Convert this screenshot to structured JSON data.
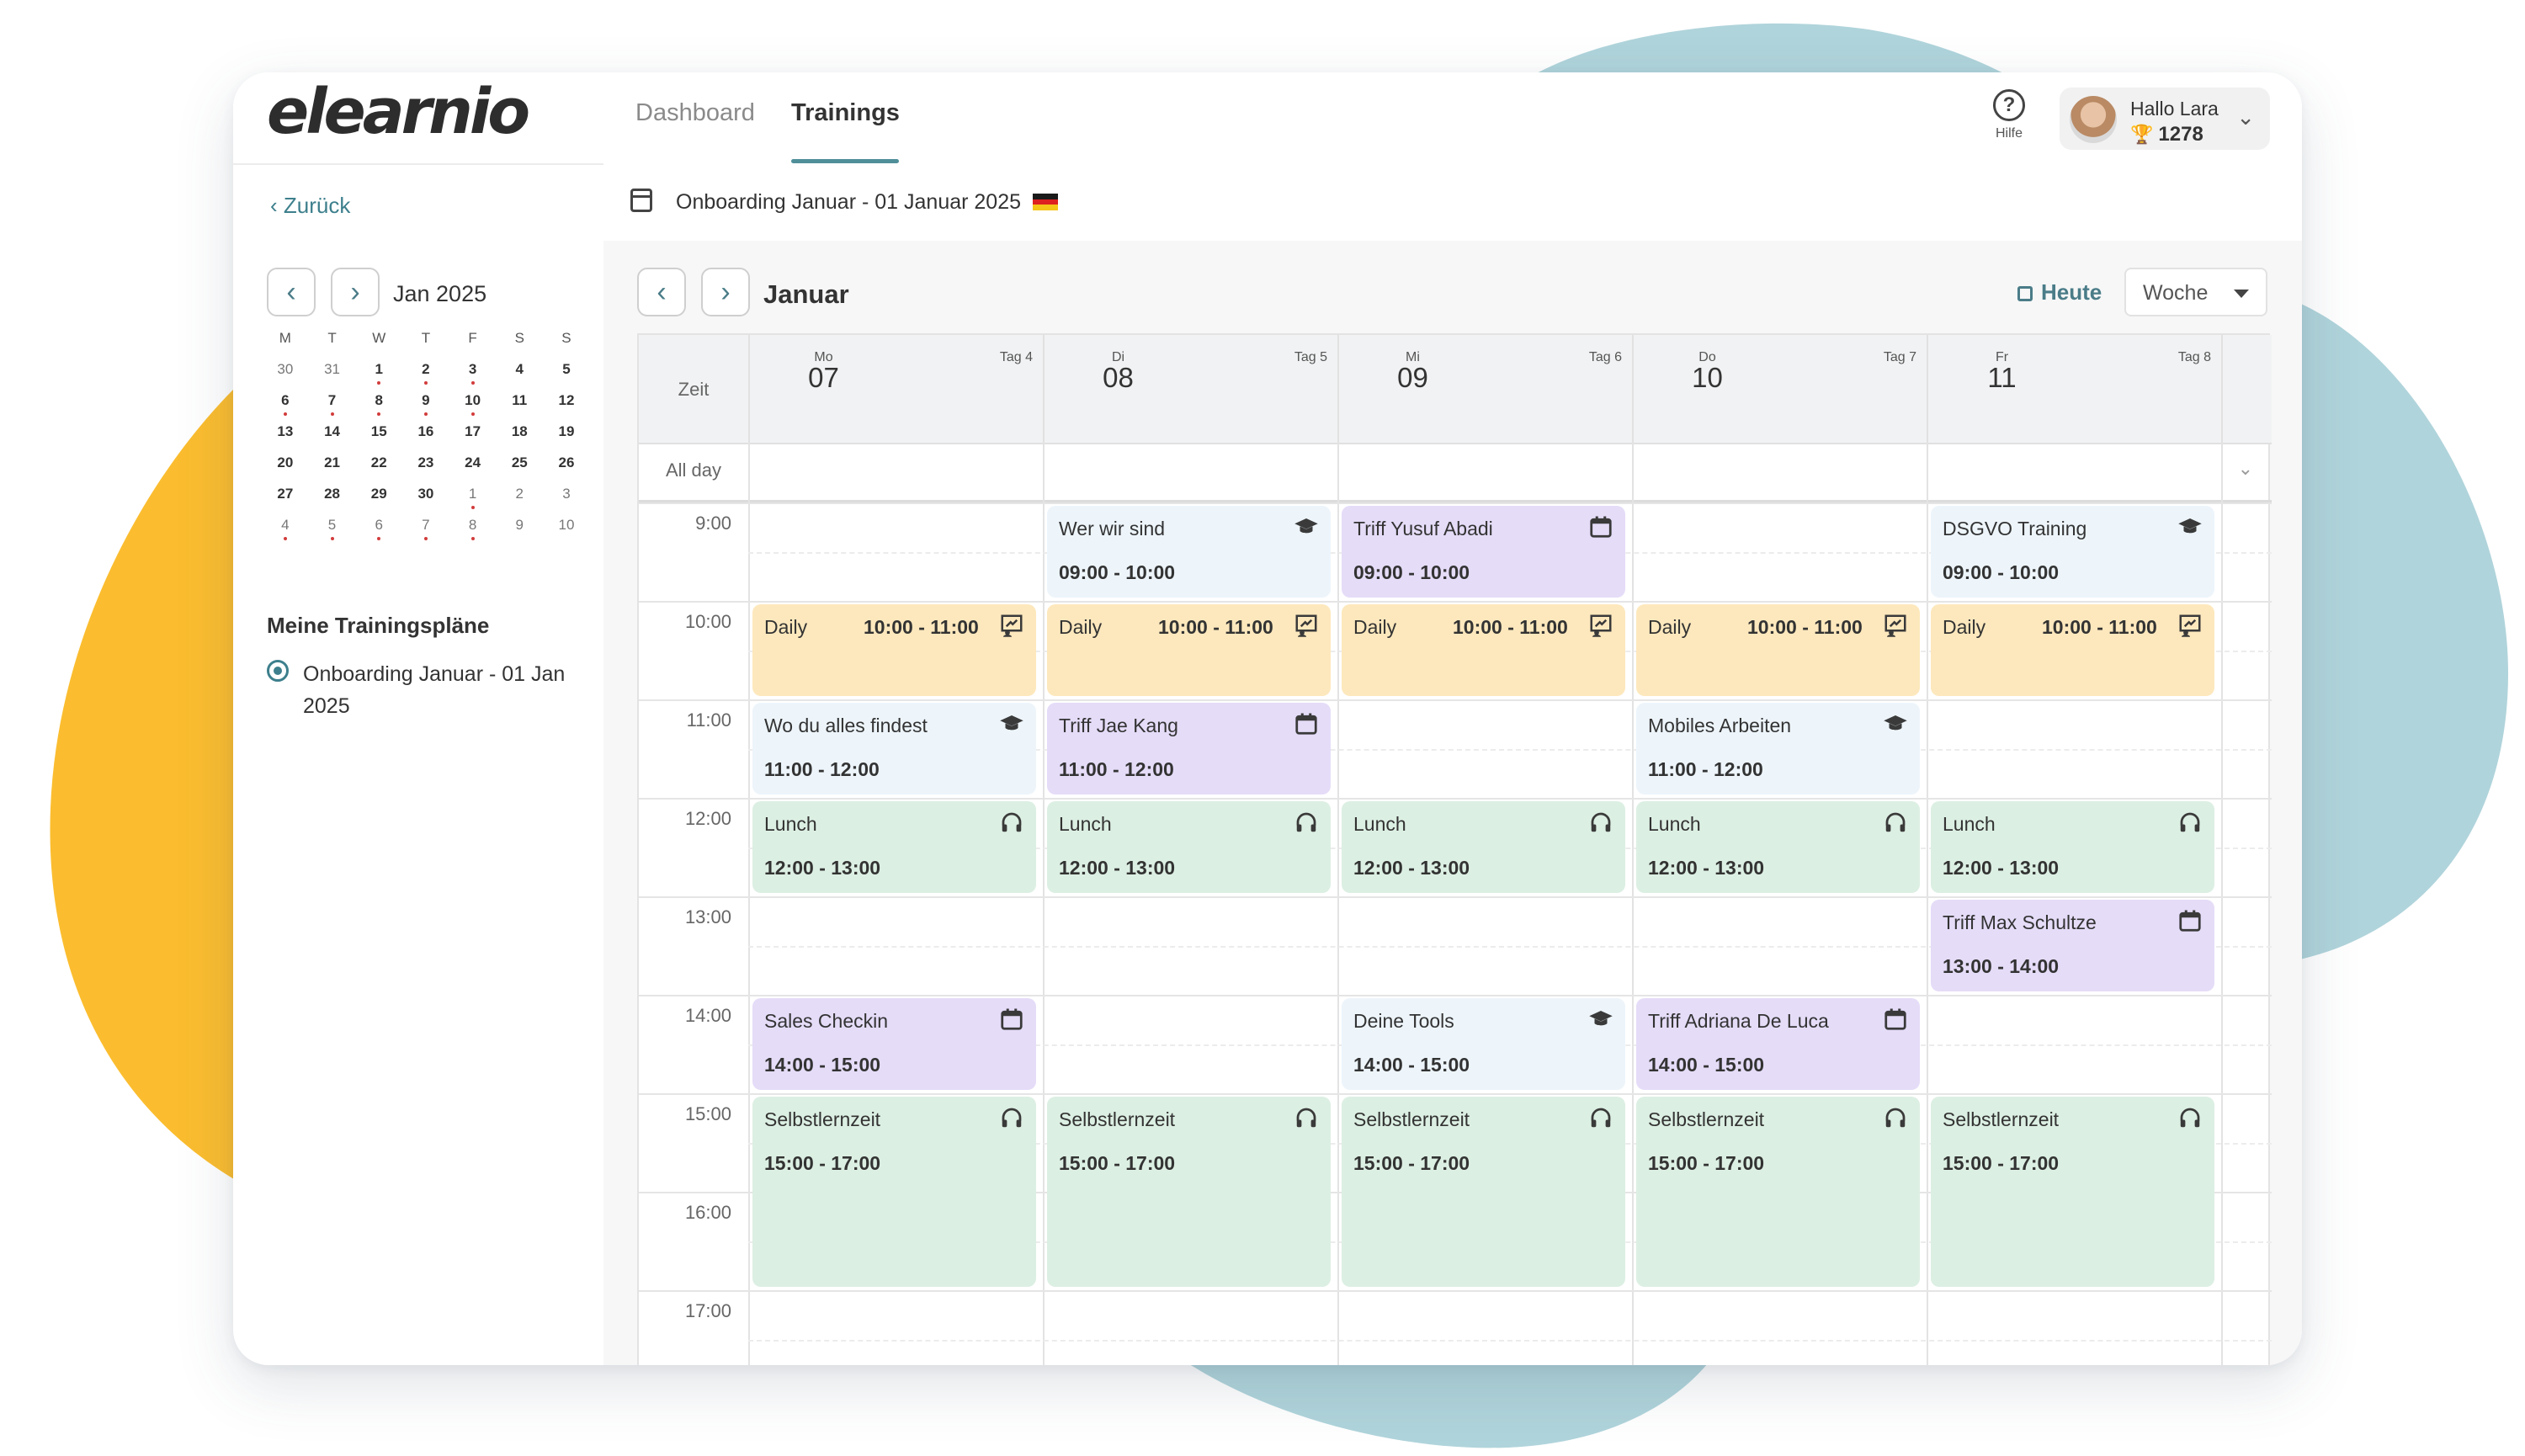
{
  "app": {
    "logo": "elearnio"
  },
  "nav": {
    "dashboard": "Dashboard",
    "trainings": "Trainings"
  },
  "help": {
    "label": "Hilfe"
  },
  "user": {
    "greeting": "Hallo Lara",
    "points": "1278"
  },
  "sidebar": {
    "back": "Zurück",
    "minical": {
      "month": "Jan 2025",
      "weekdays": [
        "M",
        "T",
        "W",
        "T",
        "F",
        "S",
        "S"
      ],
      "weeks": [
        [
          "30",
          "31",
          "1",
          "2",
          "3",
          "4",
          "5"
        ],
        [
          "6",
          "7",
          "8",
          "9",
          "10",
          "11",
          "12"
        ],
        [
          "13",
          "14",
          "15",
          "16",
          "17",
          "18",
          "19"
        ],
        [
          "20",
          "21",
          "22",
          "23",
          "24",
          "25",
          "26"
        ],
        [
          "27",
          "28",
          "29",
          "30",
          "1",
          "2",
          "3"
        ],
        [
          "4",
          "5",
          "6",
          "7",
          "8",
          "9",
          "10"
        ]
      ]
    },
    "plans_title": "Meine Trainingspläne",
    "plan": "Onboarding Januar - 01 Jan 2025"
  },
  "subheader": {
    "title": "Onboarding Januar - 01 Januar 2025"
  },
  "calendar": {
    "month": "Januar",
    "today": "Heute",
    "view": "Woche",
    "zeit": "Zeit",
    "allday": "All day",
    "days": [
      {
        "abbr": "Mo",
        "num": "07",
        "tag": "Tag 4"
      },
      {
        "abbr": "Di",
        "num": "08",
        "tag": "Tag 5"
      },
      {
        "abbr": "Mi",
        "num": "09",
        "tag": "Tag 6"
      },
      {
        "abbr": "Do",
        "num": "10",
        "tag": "Tag 7"
      },
      {
        "abbr": "Fr",
        "num": "11",
        "tag": "Tag 8"
      }
    ],
    "times": [
      "9:00",
      "10:00",
      "11:00",
      "12:00",
      "13:00",
      "14:00",
      "15:00",
      "16:00",
      "17:00"
    ],
    "events": [
      {
        "day": 1,
        "start": 9,
        "end": 10,
        "title": "Wer wir sind",
        "time": "09:00 - 10:00",
        "color": "blue",
        "icon": "graduation-cap-icon"
      },
      {
        "day": 2,
        "start": 9,
        "end": 10,
        "title": "Triff Yusuf Abadi",
        "time": "09:00 - 10:00",
        "color": "purple",
        "icon": "calendar-icon"
      },
      {
        "day": 4,
        "start": 9,
        "end": 10,
        "title": "DSGVO Training",
        "time": "09:00 - 10:00",
        "color": "blue",
        "icon": "graduation-cap-icon"
      },
      {
        "day": 0,
        "start": 10,
        "end": 11,
        "title": "Daily",
        "time": "10:00 - 11:00",
        "color": "yellow",
        "icon": "presentation-icon",
        "inline": true
      },
      {
        "day": 1,
        "start": 10,
        "end": 11,
        "title": "Daily",
        "time": "10:00 - 11:00",
        "color": "yellow",
        "icon": "presentation-icon",
        "inline": true
      },
      {
        "day": 2,
        "start": 10,
        "end": 11,
        "title": "Daily",
        "time": "10:00 - 11:00",
        "color": "yellow",
        "icon": "presentation-icon",
        "inline": true
      },
      {
        "day": 3,
        "start": 10,
        "end": 11,
        "title": "Daily",
        "time": "10:00 - 11:00",
        "color": "yellow",
        "icon": "presentation-icon",
        "inline": true
      },
      {
        "day": 4,
        "start": 10,
        "end": 11,
        "title": "Daily",
        "time": "10:00 - 11:00",
        "color": "yellow",
        "icon": "presentation-icon",
        "inline": true
      },
      {
        "day": 0,
        "start": 11,
        "end": 12,
        "title": "Wo du alles findest",
        "time": "11:00 - 12:00",
        "color": "blue",
        "icon": "graduation-cap-icon"
      },
      {
        "day": 1,
        "start": 11,
        "end": 12,
        "title": "Triff Jae Kang",
        "time": "11:00 - 12:00",
        "color": "purple",
        "icon": "calendar-icon"
      },
      {
        "day": 3,
        "start": 11,
        "end": 12,
        "title": "Mobiles Arbeiten",
        "time": "11:00 - 12:00",
        "color": "blue",
        "icon": "graduation-cap-icon"
      },
      {
        "day": 0,
        "start": 12,
        "end": 13,
        "title": "Lunch",
        "time": "12:00 - 13:00",
        "color": "green",
        "icon": "headphones-icon"
      },
      {
        "day": 1,
        "start": 12,
        "end": 13,
        "title": "Lunch",
        "time": "12:00 - 13:00",
        "color": "green",
        "icon": "headphones-icon"
      },
      {
        "day": 2,
        "start": 12,
        "end": 13,
        "title": "Lunch",
        "time": "12:00 - 13:00",
        "color": "green",
        "icon": "headphones-icon"
      },
      {
        "day": 3,
        "start": 12,
        "end": 13,
        "title": "Lunch",
        "time": "12:00 - 13:00",
        "color": "green",
        "icon": "headphones-icon"
      },
      {
        "day": 4,
        "start": 12,
        "end": 13,
        "title": "Lunch",
        "time": "12:00 - 13:00",
        "color": "green",
        "icon": "headphones-icon"
      },
      {
        "day": 4,
        "start": 13,
        "end": 14,
        "title": "Triff Max Schultze",
        "time": "13:00 - 14:00",
        "color": "purple",
        "icon": "calendar-icon"
      },
      {
        "day": 0,
        "start": 14,
        "end": 15,
        "title": "Sales Checkin",
        "time": "14:00 - 15:00",
        "color": "purple",
        "icon": "calendar-icon"
      },
      {
        "day": 2,
        "start": 14,
        "end": 15,
        "title": "Deine Tools",
        "time": "14:00 - 15:00",
        "color": "blue",
        "icon": "graduation-cap-icon"
      },
      {
        "day": 3,
        "start": 14,
        "end": 15,
        "title": "Triff Adriana De Luca",
        "time": "14:00 - 15:00",
        "color": "purple",
        "icon": "calendar-icon"
      },
      {
        "day": 0,
        "start": 15,
        "end": 17,
        "title": "Selbstlernzeit",
        "time": "15:00 - 17:00",
        "color": "green",
        "icon": "headphones-icon"
      },
      {
        "day": 1,
        "start": 15,
        "end": 17,
        "title": "Selbstlernzeit",
        "time": "15:00 - 17:00",
        "color": "green",
        "icon": "headphones-icon"
      },
      {
        "day": 2,
        "start": 15,
        "end": 17,
        "title": "Selbstlernzeit",
        "time": "15:00 - 17:00",
        "color": "green",
        "icon": "headphones-icon"
      },
      {
        "day": 3,
        "start": 15,
        "end": 17,
        "title": "Selbstlernzeit",
        "time": "15:00 - 17:00",
        "color": "green",
        "icon": "headphones-icon"
      },
      {
        "day": 4,
        "start": 15,
        "end": 17,
        "title": "Selbstlernzeit",
        "time": "15:00 - 17:00",
        "color": "green",
        "icon": "headphones-icon"
      }
    ]
  },
  "colors": {
    "accent": "#4f8f9a",
    "blob_yellow": "#fbbd2f",
    "blob_teal": "#b0d4db"
  }
}
